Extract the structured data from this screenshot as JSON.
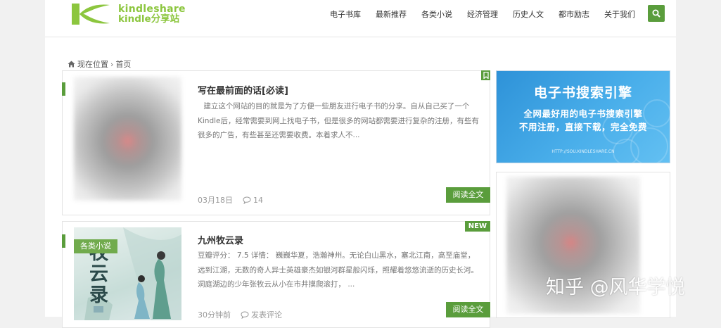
{
  "header": {
    "logo_line1": "kindleshare",
    "logo_line2": "kindle分享站",
    "nav": [
      "电子书库",
      "最新推荐",
      "各类小说",
      "经济管理",
      "历史人文",
      "都市励志",
      "关于我们"
    ]
  },
  "breadcrumb": {
    "label": "现在位置",
    "separator": "›",
    "current": "首页"
  },
  "articles": [
    {
      "title": "写在最前面的话[必读]",
      "summary": "建立这个网站的目的就是为了方便一些朋友进行电子书的分享。自从自己买了一个Kindle后，经常需要到网上找电子书，但是很多的网站都需要进行复杂的注册，有些有很多的广告，有些甚至还需要收费。本着求人不...",
      "date": "03月18日",
      "comments": "14",
      "read_label": "阅读全文"
    },
    {
      "tag": "各类小说",
      "badge": "NEW",
      "title": "九州牧云录",
      "summary": "豆瓣评分： 7.5 详情： 巍巍华夏，浩瀚神州。无论白山黑水，塞北江南，高至庙堂，远到江湖，无数的奇人异士英雄豪杰如银河群星般闪烁，照耀着悠悠流逝的历史长河。 洞庭湖边的少年张牧云从小在市井摸爬滚打， ...",
      "date": "30分钟前",
      "comments": "发表评论",
      "read_label": "阅读全文",
      "cover_text": "牧云录"
    }
  ],
  "sidebar": {
    "ad": {
      "title": "电子书搜索引擎",
      "line1": "全网最好用的电子书搜索引擎",
      "line2": "不用注册，直接下载，完全免费",
      "url": "HTTP://SOU.KINDLESHARE.CN"
    }
  },
  "watermark": "知乎 @风华学悦",
  "colors": {
    "green": "#5a9d3c",
    "logo_green": "#8cc63e",
    "ad_blue": "#3a9fe2"
  }
}
